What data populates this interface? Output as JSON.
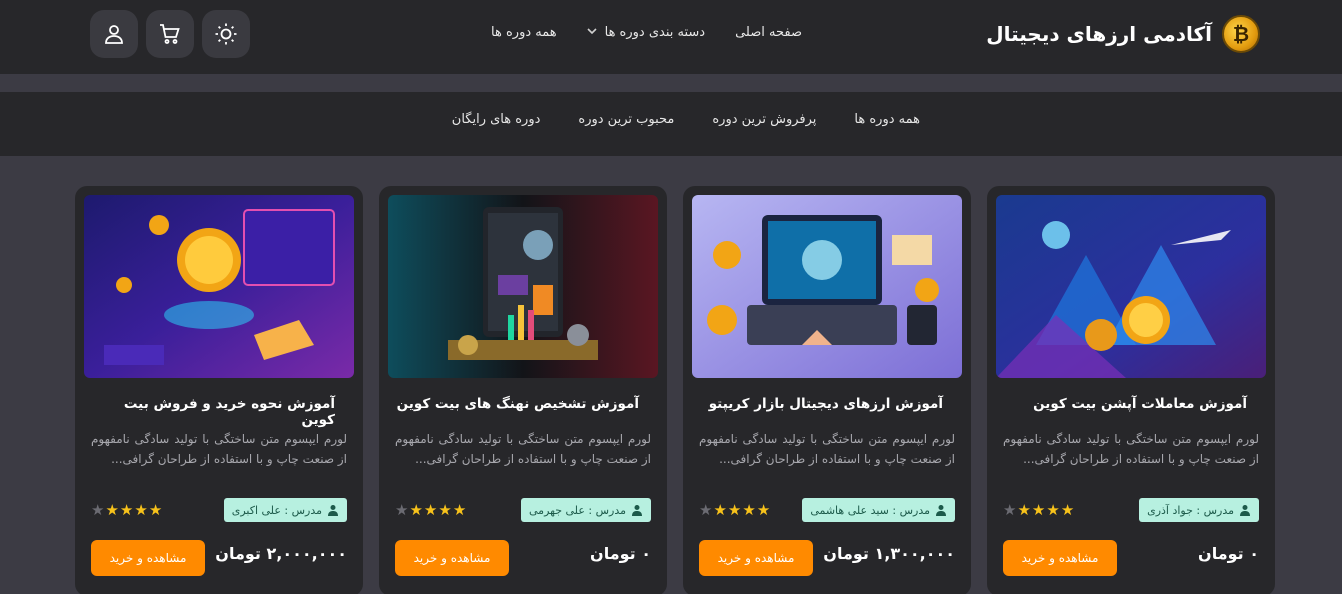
{
  "brand": {
    "name": "آکادمی ارزهای دیجیتال",
    "logo_icon": "bitcoin-logo-icon",
    "logo_glyph": "₿"
  },
  "main_nav": {
    "home": "صفحه اصلی",
    "categories": "دسته بندی دوره ها",
    "all_courses": "همه دوره ها"
  },
  "header_actions": [
    "theme-toggle-sun-icon",
    "cart-icon",
    "user-icon"
  ],
  "sub_nav": {
    "items": [
      "همه دوره ها",
      "پرفروش ترین دوره",
      "محبوب ترین دوره",
      "دوره های رایگان"
    ]
  },
  "colors": {
    "accent": "#ff8a00",
    "teacher_badge": "#b7f0e0",
    "star": "#f7c21b",
    "card_bg": "#27272a",
    "page_bg": "#3c3b44"
  },
  "cards": [
    {
      "title": "آموزش معاملات آپشن بیت کوین",
      "desc": "لورم ایپسوم متن ساختگی با تولید سادگی نامفهوم از صنعت چاپ و با استفاده از طراحان گرافی...",
      "teacher": "مدرس : جواد آذری",
      "rating": 4,
      "price": "۰ تومان",
      "button": "مشاهده و خرید"
    },
    {
      "title": "آموزش ارزهای دیجیتال بازار کریپتو",
      "desc": "لورم ایپسوم متن ساختگی با تولید سادگی نامفهوم از صنعت چاپ و با استفاده از طراحان گرافی...",
      "teacher": "مدرس : سید علی هاشمی",
      "rating": 4,
      "price": "۱,۳۰۰,۰۰۰ تومان",
      "button": "مشاهده و خرید"
    },
    {
      "title": "آموزش تشخیص نهنگ های بیت کوین",
      "desc": "لورم ایپسوم متن ساختگی با تولید سادگی نامفهوم از صنعت چاپ و با استفاده از طراحان گرافی...",
      "teacher": "مدرس : علی جهرمی",
      "rating": 4,
      "price": "۰ تومان",
      "button": "مشاهده و خرید"
    },
    {
      "title": "آموزش نحوه خرید و فروش بیت کوین",
      "desc": "لورم ایپسوم متن ساختگی با تولید سادگی نامفهوم از صنعت چاپ و با استفاده از طراحان گرافی...",
      "teacher": "مدرس : علی اکبری",
      "rating": 4,
      "price": "۲,۰۰۰,۰۰۰ تومان",
      "button": "مشاهده و خرید"
    }
  ]
}
